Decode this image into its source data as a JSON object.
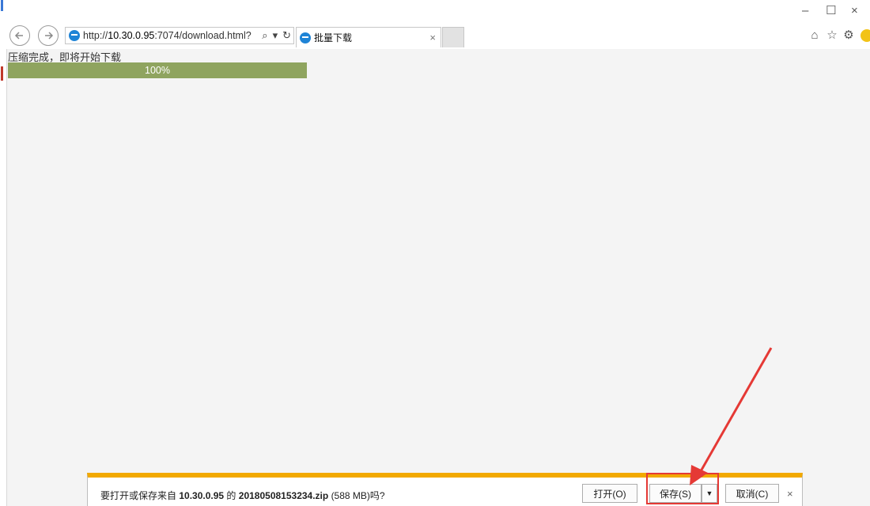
{
  "browser": {
    "url_prefix": "http://",
    "url_host": "10.30.0.95",
    "url_rest": ":7074/download.html?",
    "tab_title": "批量下载",
    "tab_close": "×",
    "search_glyph": "⌕",
    "dropdown_glyph": "▾",
    "refresh_glyph": "↻",
    "window_minimize": "–",
    "window_maximize": "☐",
    "window_close": "×",
    "toolbar_icons": [
      "home-icon",
      "favorites-icon",
      "settings-icon",
      "feedback-icon"
    ],
    "home_glyph": "⌂",
    "favorites_glyph": "☆",
    "settings_glyph": "⚙"
  },
  "page": {
    "status_text": "压缩完成，即将开始下载",
    "progress_value": 100,
    "progress_label": "100%",
    "progress_color": "#8fa45f"
  },
  "download_bar": {
    "msg_prefix": "要打开或保存来自",
    "host": "10.30.0.95",
    "msg_mid": "的",
    "filename": "20180508153234.zip",
    "size": "(588 MB)吗?",
    "open_label": "打开(O)",
    "save_label": "保存(S)",
    "save_dropdown": "▼",
    "cancel_label": "取消(C)",
    "close_glyph": "×",
    "accent_color": "#f2a900"
  },
  "annotation": {
    "highlight_color": "#e53935"
  }
}
